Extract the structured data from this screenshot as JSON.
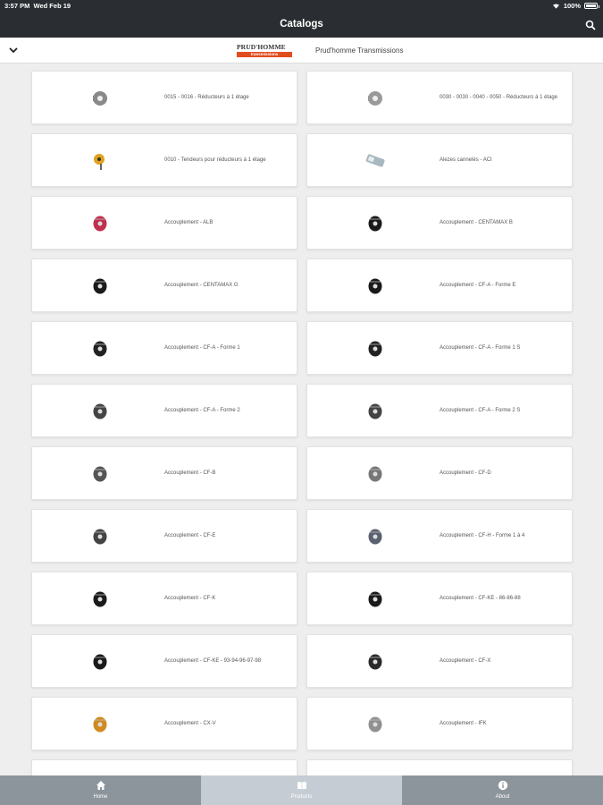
{
  "status_bar": {
    "time": "3:57 PM",
    "date": "Wed Feb 19",
    "battery": "100%"
  },
  "nav": {
    "title": "Catalogs",
    "search_icon": "search-icon"
  },
  "brand": {
    "logo_text": "PRUD'HOMME",
    "logo_band": "transmissions",
    "name": "Prud'homme Transmissions",
    "toggle_icon": "chevron-down-icon"
  },
  "catalogs": [
    {
      "label": "0015 - 0016 - Réducteurs à 1 étage",
      "icon": "gear-reducer-icon",
      "color": "#8a8a8a"
    },
    {
      "label": "0030 - 0030 - 0040 - 0050 - Réducteurs à 1 étage",
      "icon": "gear-reducer-icon",
      "color": "#9a9a9a"
    },
    {
      "label": "0010 - Tendeurs pour réducteurs à 1 étage",
      "icon": "tensioner-icon",
      "color": "#e0a020"
    },
    {
      "label": "Alezes cannelés - ACI",
      "icon": "splined-shaft-icon",
      "color": "#a8b8c0"
    },
    {
      "label": "Accouplement - ALB",
      "icon": "coupling-icon",
      "color": "#c03050"
    },
    {
      "label": "Accouplement - CENTAMAX B",
      "icon": "coupling-icon",
      "color": "#1a1a1a"
    },
    {
      "label": "Accouplement - CENTAMAX G",
      "icon": "coupling-icon",
      "color": "#1a1a1a"
    },
    {
      "label": "Accouplement - CF-A - Forme E",
      "icon": "coupling-icon",
      "color": "#1a1a1a"
    },
    {
      "label": "Accouplement - CF-A - Forme 1",
      "icon": "coupling-icon",
      "color": "#222222"
    },
    {
      "label": "Accouplement - CF-A - Forme 1 S",
      "icon": "coupling-icon",
      "color": "#222222"
    },
    {
      "label": "Accouplement - CF-A - Forme 2",
      "icon": "coupling-icon",
      "color": "#444444"
    },
    {
      "label": "Accouplement - CF-A - Forme 2 S",
      "icon": "coupling-icon",
      "color": "#444444"
    },
    {
      "label": "Accouplement - CF-B",
      "icon": "coupling-icon",
      "color": "#555555"
    },
    {
      "label": "Accouplement - CF-D",
      "icon": "coupling-icon",
      "color": "#777777"
    },
    {
      "label": "Accouplement - CF-E",
      "icon": "coupling-icon",
      "color": "#444444"
    },
    {
      "label": "Accouplement - CF-H - Forme 1 à 4",
      "icon": "coupling-icon",
      "color": "#5a6070"
    },
    {
      "label": "Accouplement - CF-K",
      "icon": "coupling-icon",
      "color": "#1a1a1a"
    },
    {
      "label": "Accouplement - CF-KE - 86-86-88",
      "icon": "coupling-icon",
      "color": "#1a1a1a"
    },
    {
      "label": "Accouplement - CF-KE - 93-94-96-97-98",
      "icon": "coupling-icon",
      "color": "#1a1a1a"
    },
    {
      "label": "Accouplement - CF-X",
      "icon": "coupling-icon",
      "color": "#2a2a2a"
    },
    {
      "label": "Accouplement - CX-V",
      "icon": "coupling-icon",
      "color": "#d08a20"
    },
    {
      "label": "Accouplement - IFK",
      "icon": "coupling-icon",
      "color": "#909090"
    },
    {
      "label": "",
      "icon": "",
      "color": ""
    },
    {
      "label": "",
      "icon": "",
      "color": ""
    }
  ],
  "tabs": [
    {
      "label": "Home",
      "icon": "home-icon",
      "active": false
    },
    {
      "label": "Products",
      "icon": "book-icon",
      "active": true
    },
    {
      "label": "About",
      "icon": "info-icon",
      "active": false
    }
  ]
}
